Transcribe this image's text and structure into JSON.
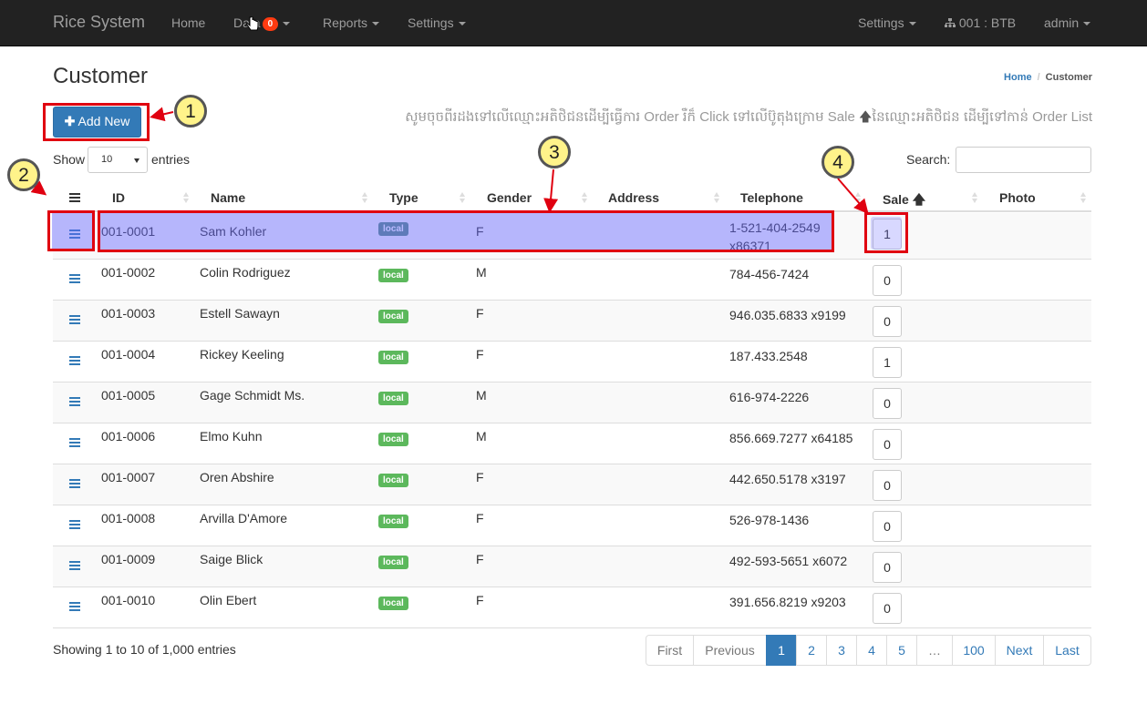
{
  "navbar": {
    "brand": "Rice System",
    "items": [
      {
        "label": "Home"
      },
      {
        "label": "Data",
        "badge": "0"
      },
      {
        "label": "Reports"
      },
      {
        "label": "Settings"
      }
    ],
    "right_items": [
      {
        "label": "Settings"
      },
      {
        "label": "001 : BTB",
        "icon": "sitemap-icon"
      },
      {
        "label": "admin"
      }
    ]
  },
  "page": {
    "title": "Customer",
    "breadcrumb": [
      "Home",
      "Customer"
    ]
  },
  "toolbar": {
    "add_label": "Add New",
    "instruction_part1": "សូមចុចពីរដងទៅលើឈ្មោះអតិថិជនដើម្បីធ្វើការ Order រឺក៏ Click ទៅលើប៊ូតុងក្រោម Sale",
    "instruction_part2": "នៃឈ្មោះអតិថិជន ដើម្បីទៅកាន់ Order List"
  },
  "length": {
    "show_label": "Show",
    "value": "10",
    "entries_label": "entries"
  },
  "search": {
    "label": "Search:",
    "placeholder": ""
  },
  "table": {
    "columns": [
      "ID",
      "Name",
      "Type",
      "Gender",
      "Address",
      "Telephone",
      "Sale",
      "Photo"
    ],
    "rows": [
      {
        "id": "001-0001",
        "name": "Sam Kohler",
        "type": "local",
        "gender": "F",
        "address": "",
        "telephone": "1-521-404-2549 x86371",
        "sale": "1"
      },
      {
        "id": "001-0002",
        "name": "Colin Rodriguez",
        "type": "local",
        "gender": "M",
        "address": "",
        "telephone": "784-456-7424",
        "sale": "0"
      },
      {
        "id": "001-0003",
        "name": "Estell Sawayn",
        "type": "local",
        "gender": "F",
        "address": "",
        "telephone": "946.035.6833 x9199",
        "sale": "0"
      },
      {
        "id": "001-0004",
        "name": "Rickey Keeling",
        "type": "local",
        "gender": "F",
        "address": "",
        "telephone": "187.433.2548",
        "sale": "1"
      },
      {
        "id": "001-0005",
        "name": "Gage Schmidt Ms.",
        "type": "local",
        "gender": "M",
        "address": "",
        "telephone": "616-974-2226",
        "sale": "0"
      },
      {
        "id": "001-0006",
        "name": "Elmo Kuhn",
        "type": "local",
        "gender": "M",
        "address": "",
        "telephone": "856.669.7277 x64185",
        "sale": "0"
      },
      {
        "id": "001-0007",
        "name": "Oren Abshire",
        "type": "local",
        "gender": "F",
        "address": "",
        "telephone": "442.650.5178 x3197",
        "sale": "0"
      },
      {
        "id": "001-0008",
        "name": "Arvilla D'Amore",
        "type": "local",
        "gender": "F",
        "address": "",
        "telephone": "526-978-1436",
        "sale": "0"
      },
      {
        "id": "001-0009",
        "name": "Saige Blick",
        "type": "local",
        "gender": "F",
        "address": "",
        "telephone": "492-593-5651 x6072",
        "sale": "0"
      },
      {
        "id": "001-0010",
        "name": "Olin Ebert",
        "type": "local",
        "gender": "F",
        "address": "",
        "telephone": "391.656.8219 x9203",
        "sale": "0"
      }
    ]
  },
  "footer": {
    "info": "Showing 1 to 10 of 1,000 entries",
    "pagination": [
      "First",
      "Previous",
      "1",
      "2",
      "3",
      "4",
      "5",
      "…",
      "100",
      "Next",
      "Last"
    ],
    "active_page": "1"
  },
  "annotations": [
    "1",
    "2",
    "3",
    "4"
  ],
  "colors": {
    "primary": "#337ab7",
    "success": "#5cb85c",
    "navbar": "#222222",
    "badge": "#ff3b11",
    "annotation_red": "#e00010",
    "callout_fill": "#fff38a"
  }
}
